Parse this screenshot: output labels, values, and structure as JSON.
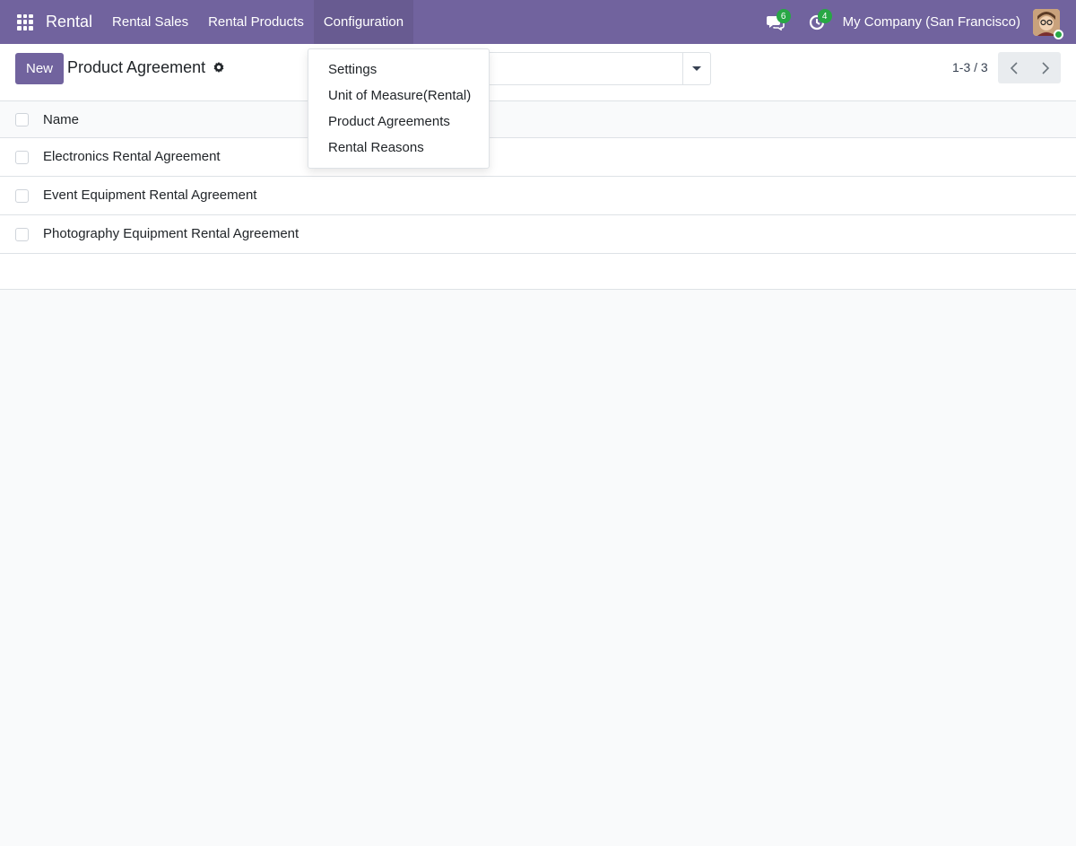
{
  "navbar": {
    "brand": "Rental",
    "menu": [
      {
        "label": "Rental Sales"
      },
      {
        "label": "Rental Products"
      },
      {
        "label": "Configuration"
      }
    ],
    "messages_badge": "6",
    "activities_badge": "4",
    "company": "My Company (San Francisco)",
    "accent_color": "#71639e",
    "status_color": "#28a745"
  },
  "control_panel": {
    "new_label": "New",
    "title": "Product Agreement",
    "pager": "1-3 / 3"
  },
  "list": {
    "column_name": "Name",
    "rows": [
      {
        "name": "Electronics Rental Agreement"
      },
      {
        "name": "Event Equipment Rental Agreement"
      },
      {
        "name": "Photography Equipment Rental Agreement"
      }
    ]
  },
  "dropdown": {
    "items": [
      {
        "label": "Settings"
      },
      {
        "label": "Unit of Measure(Rental)"
      },
      {
        "label": "Product Agreements"
      },
      {
        "label": "Rental Reasons"
      }
    ]
  },
  "icons": {
    "apps": "grid-icon",
    "messages": "chat-icon",
    "activities": "clock-icon",
    "settings": "gear-icon",
    "search_options": "caret-down-icon",
    "prev": "chevron-left-icon",
    "next": "chevron-right-icon"
  }
}
